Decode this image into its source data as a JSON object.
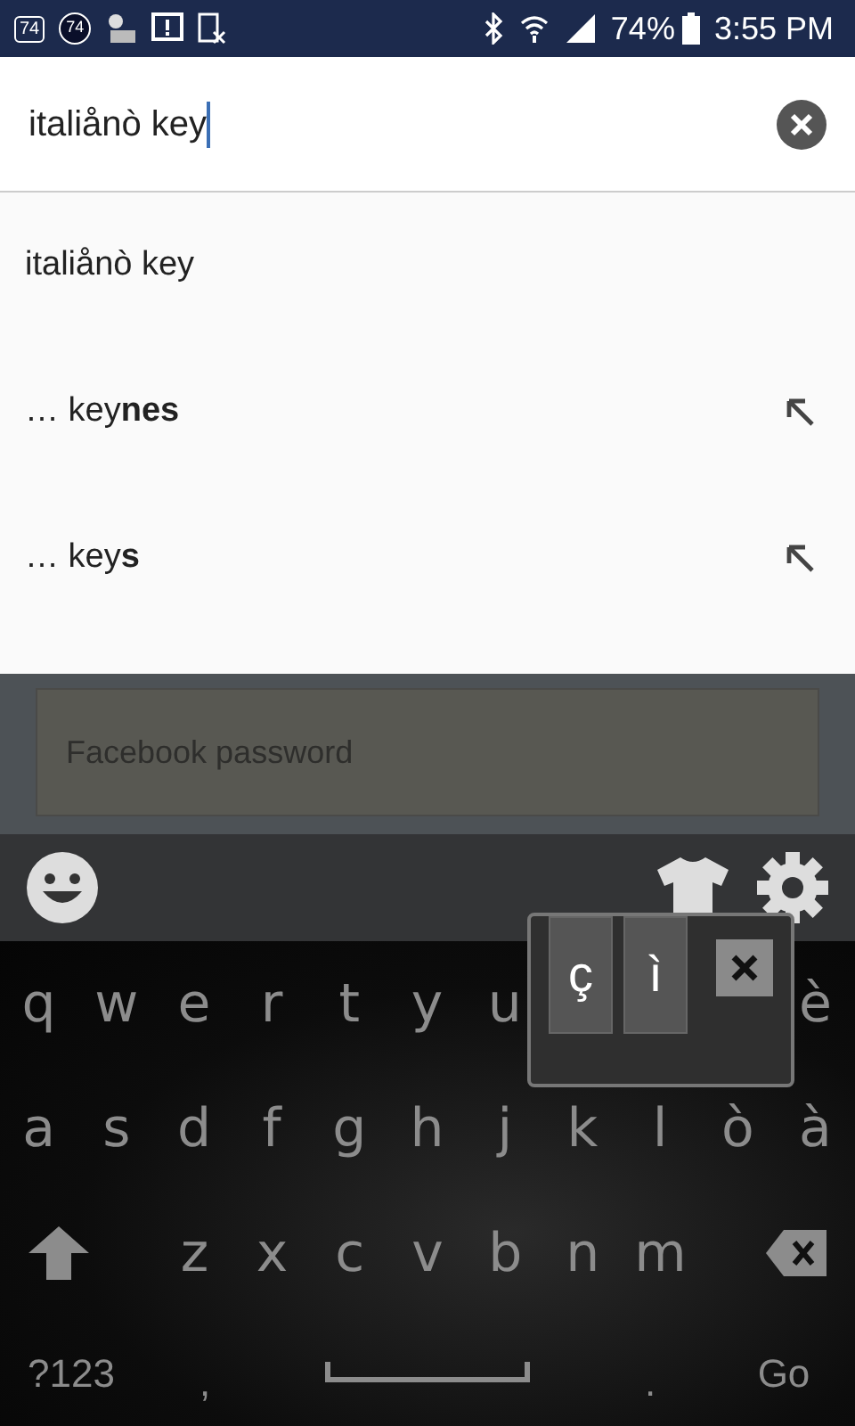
{
  "status_bar": {
    "badges": [
      {
        "kind": "box",
        "text": "74"
      },
      {
        "kind": "circle",
        "text": "74"
      }
    ],
    "battery": "74%",
    "time": "3:55 PM"
  },
  "search": {
    "value": "italiånò key"
  },
  "suggestions": [
    {
      "kind": "query",
      "text": "italiånò key"
    },
    {
      "kind": "completion",
      "text": "… key**nes**"
    },
    {
      "kind": "completion",
      "text": "… key**s**"
    }
  ],
  "background_field": {
    "placeholder": "Facebook password"
  },
  "keyboard": {
    "top_row": [
      {
        "kind": "char",
        "label": "q"
      },
      {
        "kind": "char",
        "label": "w"
      },
      {
        "kind": "char",
        "label": "e"
      },
      {
        "kind": "char",
        "label": "r"
      },
      {
        "kind": "char",
        "label": "t"
      },
      {
        "kind": "char",
        "label": "y"
      },
      {
        "kind": "char",
        "label": "u"
      },
      {
        "kind": "hidden"
      },
      {
        "kind": "hidden"
      },
      {
        "kind": "hidden"
      },
      {
        "kind": "char",
        "label": "è"
      }
    ],
    "home_row": [
      {
        "kind": "char",
        "label": "a"
      },
      {
        "kind": "char",
        "label": "s"
      },
      {
        "kind": "char",
        "label": "d"
      },
      {
        "kind": "char",
        "label": "f"
      },
      {
        "kind": "char",
        "label": "g"
      },
      {
        "kind": "char",
        "label": "h"
      },
      {
        "kind": "char",
        "label": "j"
      },
      {
        "kind": "char",
        "label": "k"
      },
      {
        "kind": "char",
        "label": "l"
      },
      {
        "kind": "char",
        "label": "ò"
      },
      {
        "kind": "char",
        "label": "à"
      }
    ],
    "shift_key": {
      "kind": "shift"
    },
    "bottom_letters": [
      {
        "kind": "char",
        "label": "z"
      },
      {
        "kind": "char",
        "label": "x"
      },
      {
        "kind": "char",
        "label": "c"
      },
      {
        "kind": "char",
        "label": "v"
      },
      {
        "kind": "char",
        "label": "b"
      },
      {
        "kind": "char",
        "label": "n"
      },
      {
        "kind": "char",
        "label": "m"
      }
    ],
    "backspace_key": {
      "kind": "backspace"
    },
    "function_row": [
      {
        "kind": "symbols",
        "label": "?123"
      },
      {
        "kind": "punct",
        "label": ","
      },
      {
        "kind": "space"
      },
      {
        "kind": "punct",
        "label": "."
      },
      {
        "kind": "go",
        "label": "Go"
      }
    ],
    "popup": {
      "keys": [
        "ç",
        "ì"
      ]
    }
  }
}
